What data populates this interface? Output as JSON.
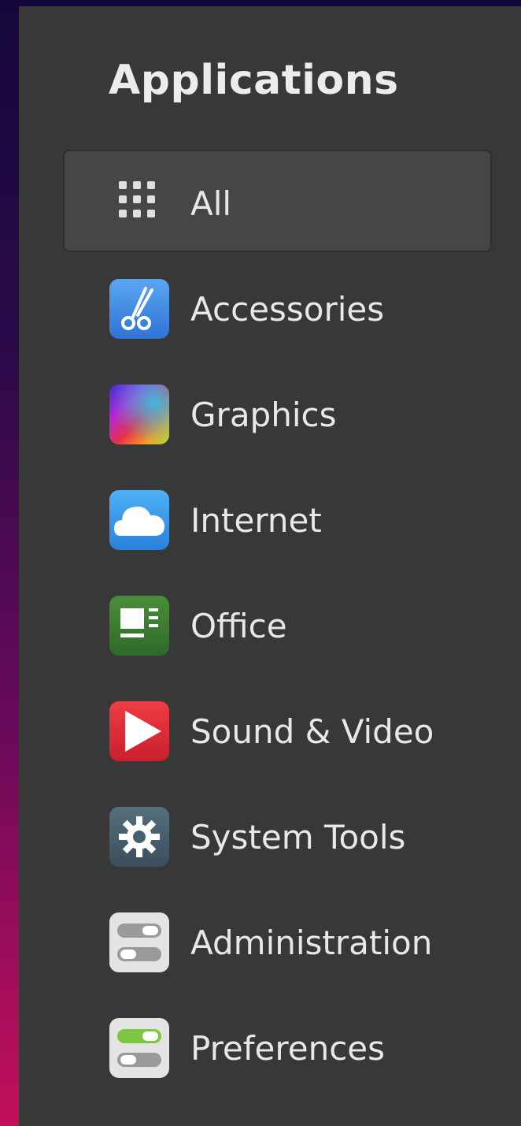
{
  "menu": {
    "title": "Applications",
    "selected_index": 0,
    "categories": [
      {
        "label": "All",
        "icon": "apps-grid-icon"
      },
      {
        "label": "Accessories",
        "icon": "scissors-icon"
      },
      {
        "label": "Graphics",
        "icon": "color-palette-icon"
      },
      {
        "label": "Internet",
        "icon": "cloud-icon"
      },
      {
        "label": "Office",
        "icon": "document-icon"
      },
      {
        "label": "Sound & Video",
        "icon": "play-icon"
      },
      {
        "label": "System Tools",
        "icon": "gear-icon"
      },
      {
        "label": "Administration",
        "icon": "toggle-switches-icon"
      },
      {
        "label": "Preferences",
        "icon": "toggle-switches-on-icon"
      }
    ]
  },
  "colors": {
    "panel_bg": "#383838",
    "selected_bg": "#464646",
    "text": "#e8e8e8",
    "accessories": "#4a8fe0",
    "internet": "#3a9ae8",
    "office": "#3e7a34",
    "sound_video": "#e0303a",
    "system_tools": "#4a6070",
    "preferences_on": "#7cc644"
  }
}
